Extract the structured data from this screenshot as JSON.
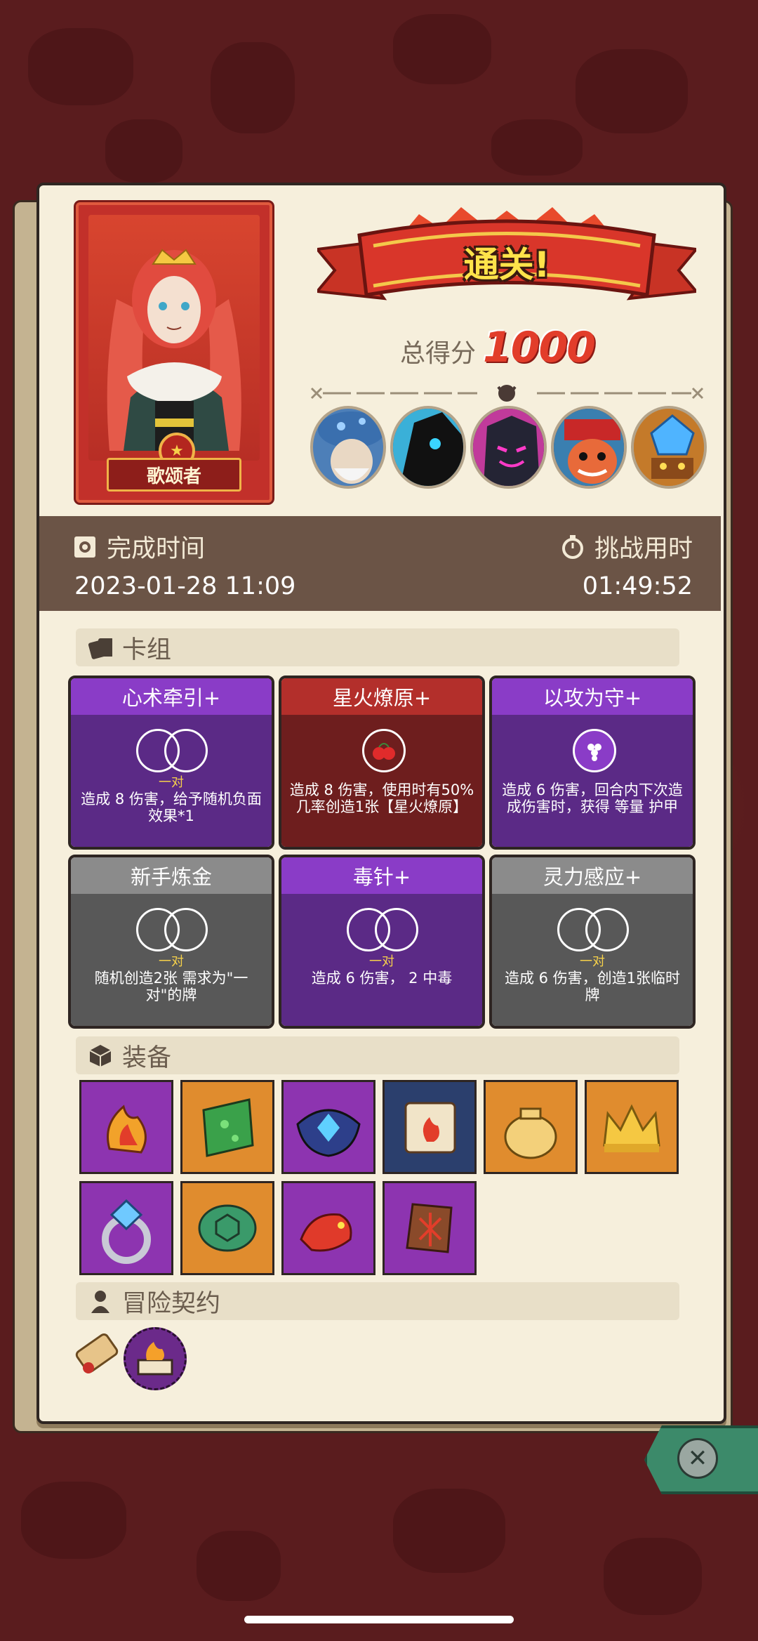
{
  "hero": {
    "name": "歌颂者"
  },
  "result": {
    "banner": "通关!",
    "score_label": "总得分",
    "score_value": "1000"
  },
  "bosses": [
    "mushroom-sage-icon",
    "shadow-beast-icon",
    "dark-knight-icon",
    "clown-icon",
    "crystal-golem-icon"
  ],
  "time": {
    "complete_label": "完成时间",
    "complete_value": "2023-01-28 11:09",
    "challenge_label": "挑战用时",
    "challenge_value": "01:49:52"
  },
  "deck": {
    "header": "卡组",
    "cards": [
      {
        "title": "心术牵引+",
        "sub": "一对",
        "desc": "造成 8 伤害，给予随机负面效果*1"
      },
      {
        "title": "星火燎原+",
        "sub": "",
        "desc": "造成 8 伤害，使用时有50%几率创造1张【星火燎原】"
      },
      {
        "title": "以攻为守+",
        "sub": "",
        "desc": "造成 6 伤害，回合内下次造成伤害时，获得 等量 护甲"
      },
      {
        "title": "新手炼金",
        "sub": "一对",
        "desc": "随机创造2张 需求为\"一对\"的牌"
      },
      {
        "title": "毒针+",
        "sub": "一对",
        "desc": "造成 6 伤害， 2 中毒"
      },
      {
        "title": "灵力感应+",
        "sub": "一对",
        "desc": "造成 6 伤害，创造1张临时牌"
      }
    ]
  },
  "equipment": {
    "header": "装备",
    "items": [
      "flame-amulet-icon",
      "green-slab-icon",
      "sapphire-crown-icon",
      "fire-scroll-icon",
      "coin-sack-icon",
      "gold-crown-icon",
      "diamond-ring-icon",
      "turtle-shell-icon",
      "red-dragon-icon",
      "wood-rune-icon"
    ]
  },
  "contract": {
    "header": "冒险契约",
    "items": [
      "scroll-icon",
      "fire-book-icon"
    ]
  },
  "colors": {
    "panel": "#f6efdc",
    "background": "#5a1c1e",
    "score": "#e23d2a",
    "banner_text": "#ffe34a"
  }
}
